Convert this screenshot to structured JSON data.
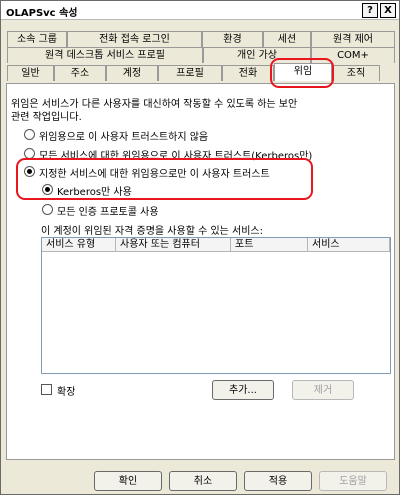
{
  "window": {
    "title": "OLAPSvc 속성",
    "help_label": "?",
    "close_label": "X"
  },
  "tabs": {
    "row1": [
      "소속 그룹",
      "전화 접속 로그인",
      "환경",
      "세션",
      "원격 제어"
    ],
    "row2": [
      "원격 데스크톱 서비스 프로필",
      "개인 가상",
      "COM+"
    ],
    "row3": [
      "일반",
      "주소",
      "계정",
      "프로필",
      "전화",
      "위임",
      "조직"
    ],
    "active": "위임"
  },
  "delegation": {
    "description_line1": "위임은 서비스가 다른 사용자를 대신하여 작동할 수 있도록 하는 보안",
    "description_line2": "관련 작업입니다.",
    "options": [
      {
        "label": "위임용으로 이 사용자 트러스트하지 않음",
        "selected": false
      },
      {
        "label": "모든 서비스에 대한 위임용으로 이 사용자 트러스트(Kerberos만)",
        "selected": false
      },
      {
        "label": "지정한 서비스에 대한 위임용으로만 이 사용자 트러스트",
        "selected": true
      }
    ],
    "sub_options": [
      {
        "label": "Kerberos만 사용",
        "selected": true
      },
      {
        "label": "모든 인증 프로토콜 사용",
        "selected": false
      }
    ],
    "services_label": "이 계정이 위임된 자격 증명을 사용할 수 있는 서비스:",
    "columns": [
      "서비스 유형",
      "사용자 또는 컴퓨터",
      "포트",
      "서비스"
    ],
    "rows": [],
    "expand_label": "확장",
    "expand_checked": false,
    "add_button": "추가...",
    "remove_button": "제거"
  },
  "footer": {
    "ok": "확인",
    "cancel": "취소",
    "apply": "적용",
    "help": "도움말"
  },
  "colors": {
    "highlight": "#e8171e",
    "dialog_bg": "#ece9d8",
    "disabled_text": "#a0a0a0"
  }
}
